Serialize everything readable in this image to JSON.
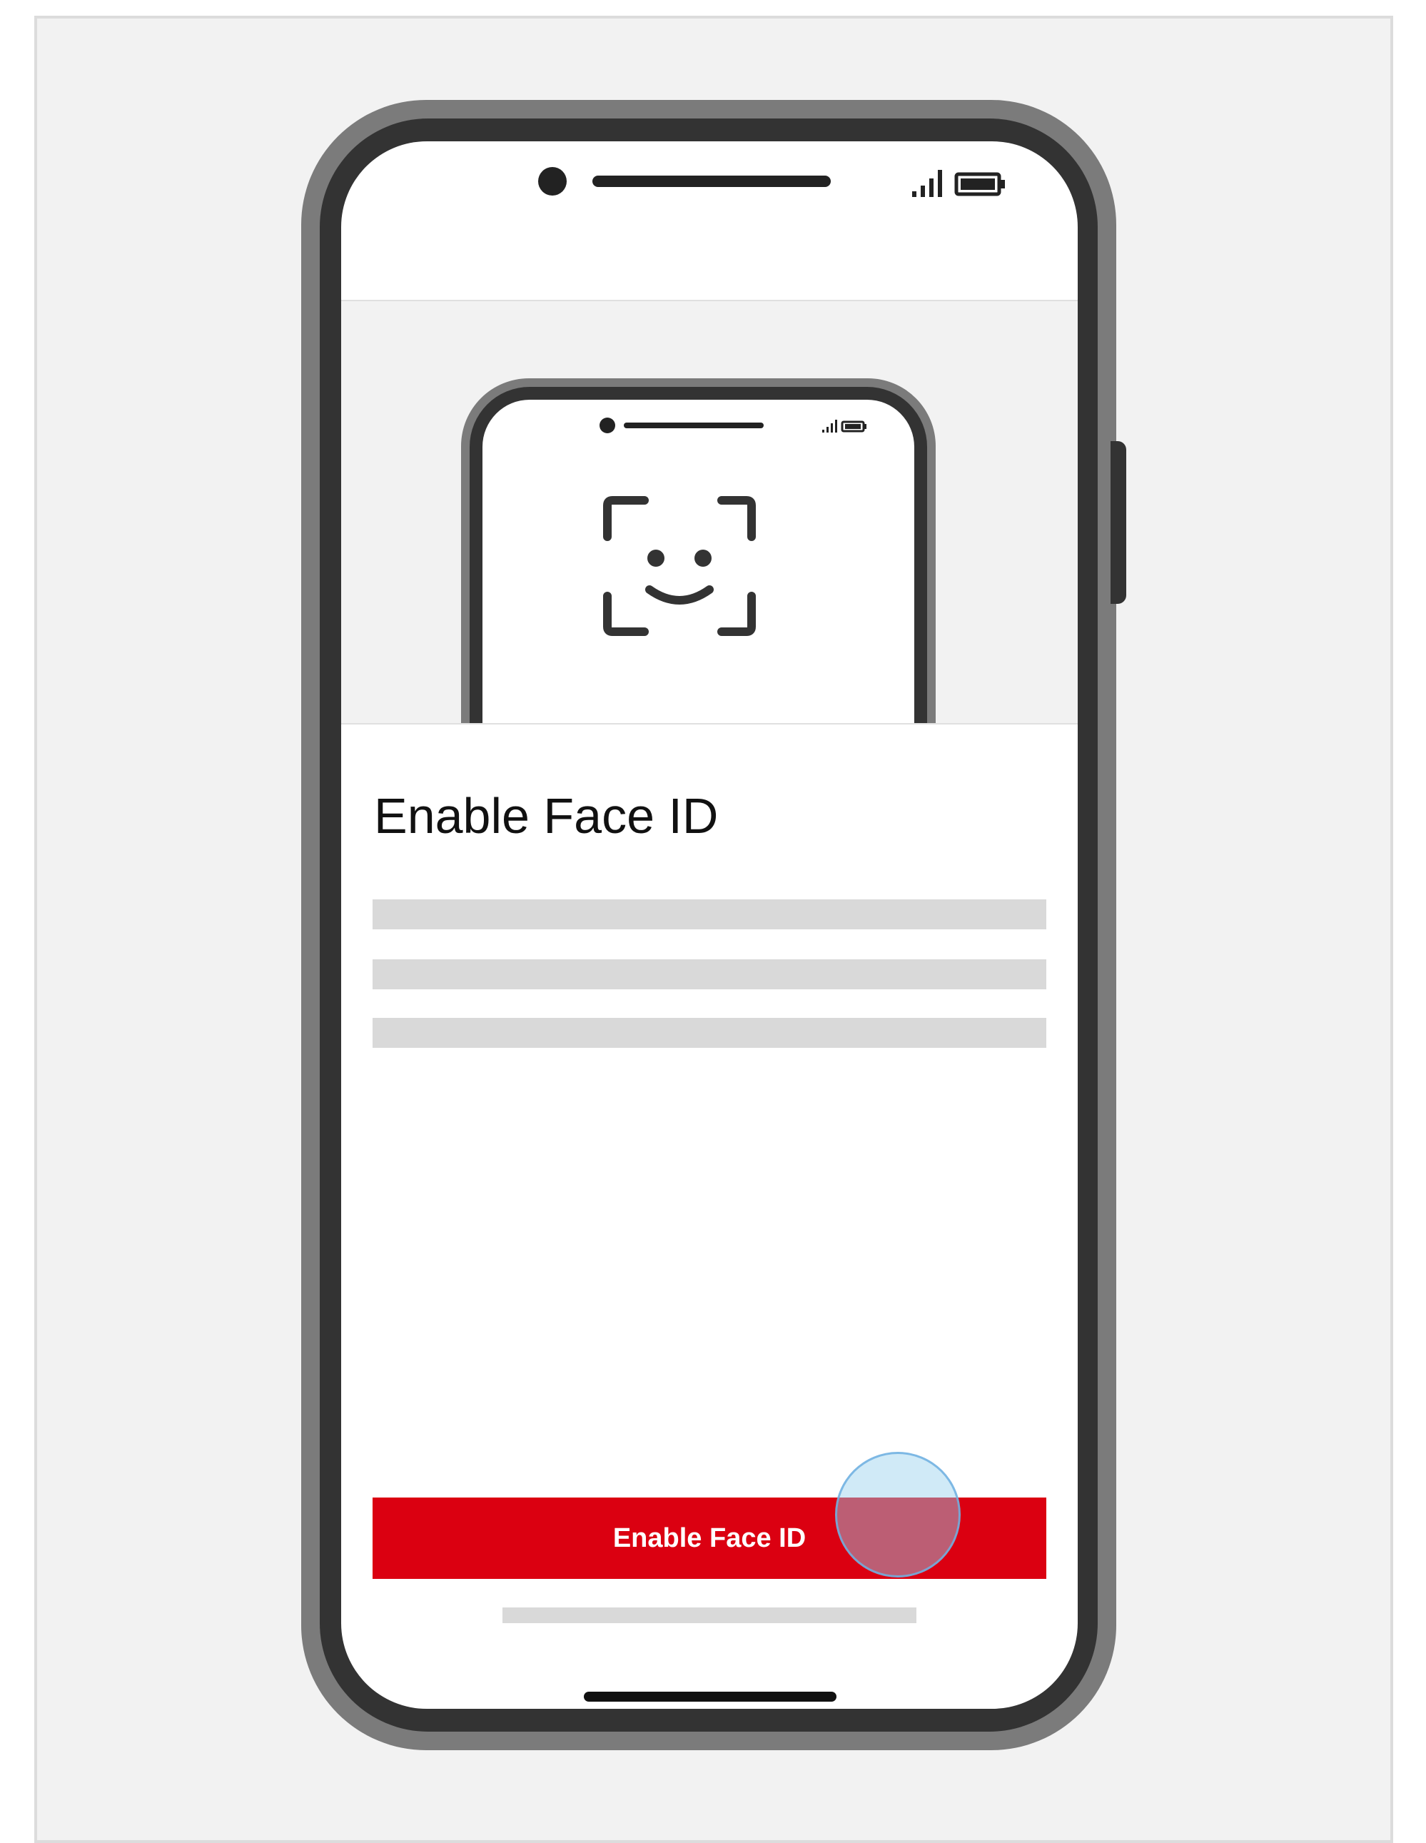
{
  "screen": {
    "title": "Enable Face ID",
    "primary_button_label": "Enable Face ID",
    "hero_icon": "face-id-icon",
    "placeholder_lines": 3
  },
  "status_bar": {
    "signal_icon": "signal-bars-icon",
    "battery_icon": "battery-icon"
  },
  "colors": {
    "accent": "#db0011",
    "placeholder": "#d9d9d9",
    "phone_body": "#333333",
    "phone_bezel": "#7b7b7b",
    "background": "#f2f2f2",
    "tap_indicator": "#96d0ee"
  }
}
